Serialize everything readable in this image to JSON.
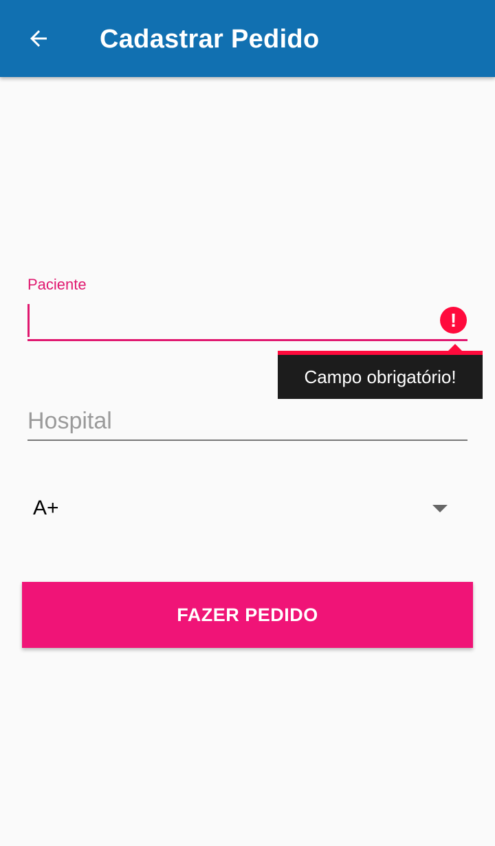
{
  "app_bar": {
    "title": "Cadastrar Pedido",
    "back_icon": "arrow-left-icon",
    "background_color": "#1170b1"
  },
  "form": {
    "paciente": {
      "label": "Paciente",
      "value": "",
      "error_icon": "exclamation-circle-icon",
      "error_message": "Campo obrigatório!"
    },
    "hospital": {
      "placeholder": "Hospital",
      "value": ""
    },
    "blood_type": {
      "selected": "A+",
      "dropdown_icon": "caret-down-icon"
    },
    "submit_label": "FAZER PEDIDO"
  },
  "colors": {
    "accent": "#e0186f",
    "button": "#f01477",
    "error": "#ff0a3c",
    "tooltip_bg": "#1c1c1c"
  }
}
